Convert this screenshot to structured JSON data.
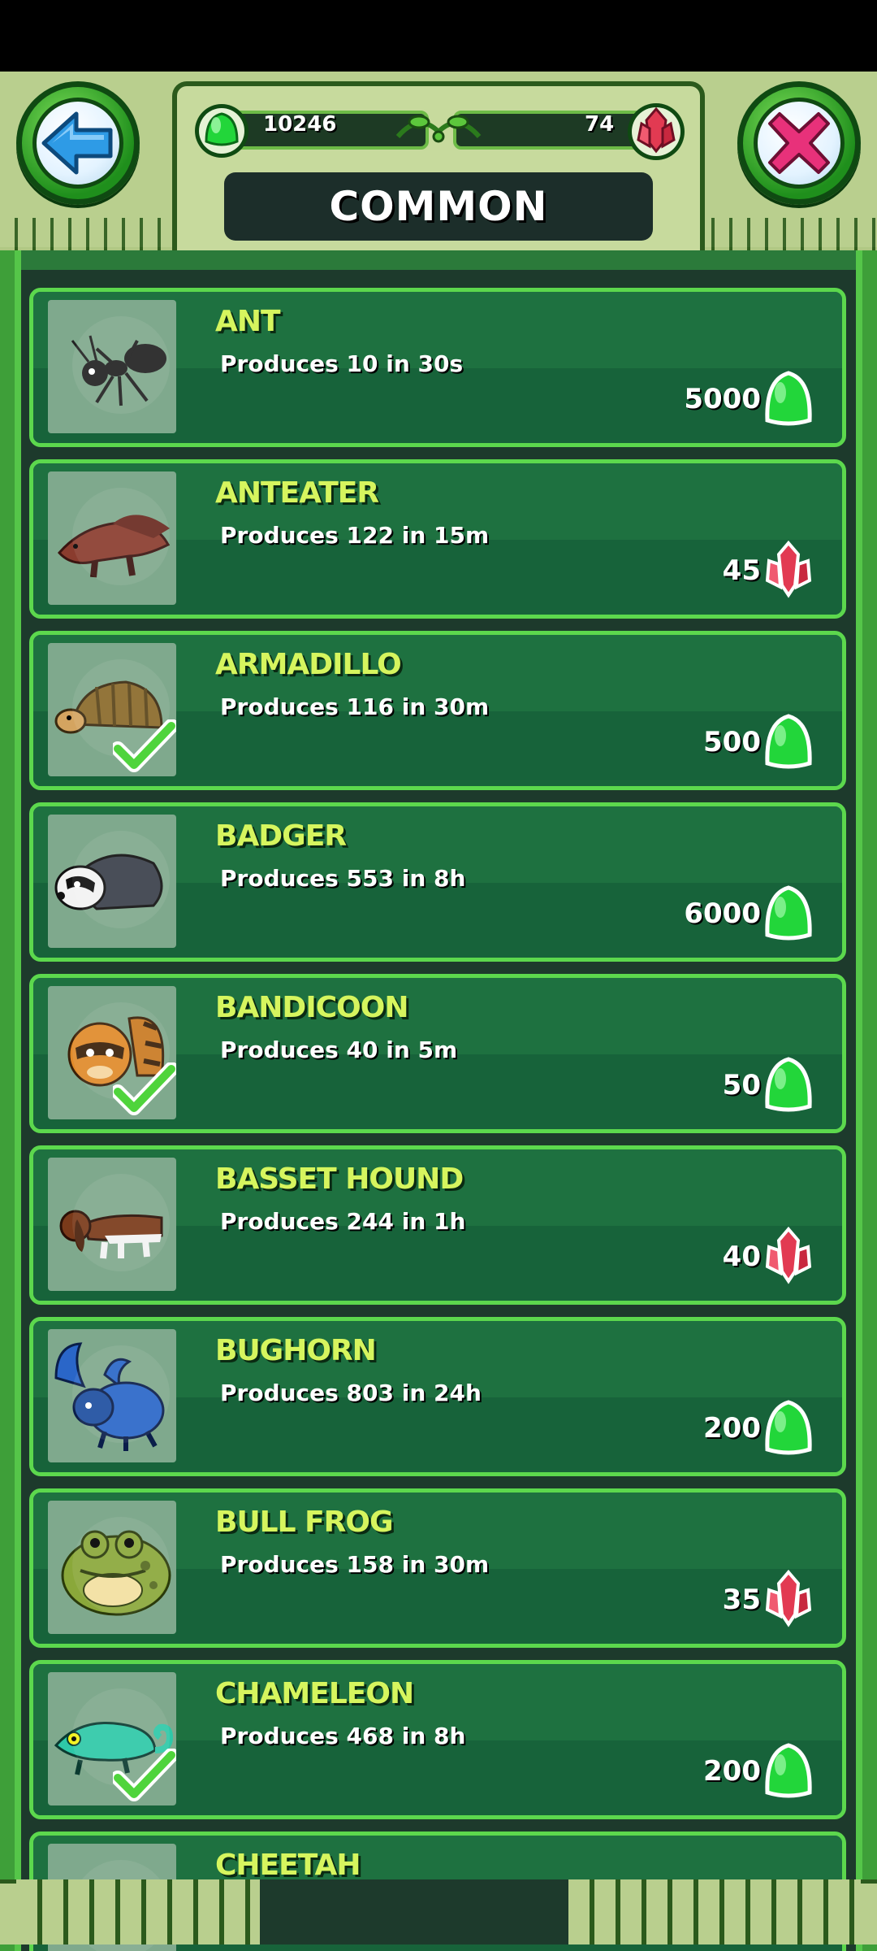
{
  "header": {
    "title": "COMMON",
    "gems": "10246",
    "crystals": "74",
    "back_icon": "back-arrow-icon",
    "close_icon": "close-x-icon"
  },
  "colors": {
    "name_text": "#d6f55e",
    "card_border": "#5cd84d",
    "gem_green": "#22d63a",
    "crystal_red": "#e23a52"
  },
  "creatures": [
    {
      "name": "ANT",
      "produces": "Produces 10 in 30s",
      "price": "5000",
      "currency": "gem",
      "owned": false
    },
    {
      "name": "ANTEATER",
      "produces": "Produces 122 in 15m",
      "price": "45",
      "currency": "crystal",
      "owned": false
    },
    {
      "name": "ARMADILLO",
      "produces": "Produces 116 in 30m",
      "price": "500",
      "currency": "gem",
      "owned": true
    },
    {
      "name": "BADGER",
      "produces": "Produces 553 in 8h",
      "price": "6000",
      "currency": "gem",
      "owned": false
    },
    {
      "name": "BANDICOON",
      "produces": "Produces 40 in 5m",
      "price": "50",
      "currency": "gem",
      "owned": true
    },
    {
      "name": "BASSET HOUND",
      "produces": "Produces 244 in 1h",
      "price": "40",
      "currency": "crystal",
      "owned": false
    },
    {
      "name": "BUGHORN",
      "produces": "Produces 803 in 24h",
      "price": "200",
      "currency": "gem",
      "owned": false
    },
    {
      "name": "BULL FROG",
      "produces": "Produces 158 in 30m",
      "price": "35",
      "currency": "crystal",
      "owned": false
    },
    {
      "name": "CHAMELEON",
      "produces": "Produces 468 in 8h",
      "price": "200",
      "currency": "gem",
      "owned": true
    },
    {
      "name": "CHEETAH",
      "produces": "",
      "price": "",
      "currency": "",
      "owned": false
    }
  ]
}
